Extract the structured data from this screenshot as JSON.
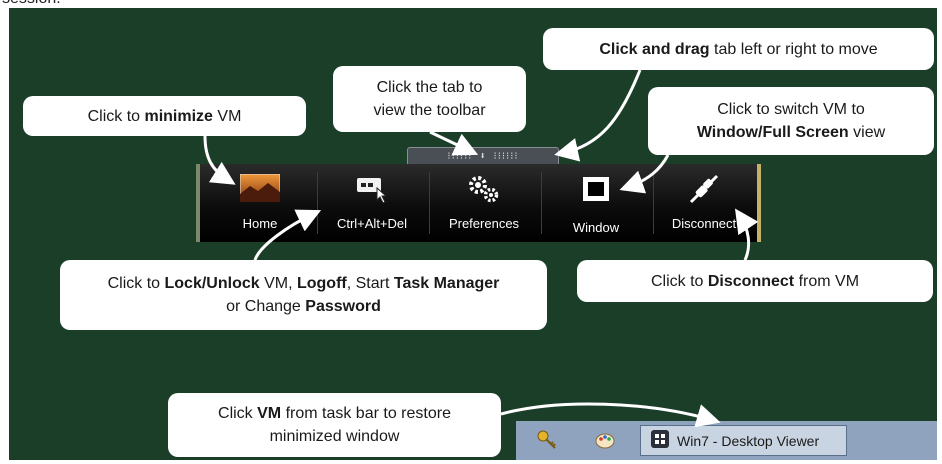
{
  "header_text": "session.",
  "toolbar_tab_label": "⁝⁝⁝⁝⁝⁝ ⬇ ⁝⁝⁝⁝⁝⁝",
  "toolbar": {
    "buttons": [
      {
        "label": "Home",
        "icon": "home-landscape-icon"
      },
      {
        "label": "Ctrl+Alt+Del",
        "icon": "ctrl-alt-del-icon"
      },
      {
        "label": "Preferences",
        "icon": "gears-icon"
      },
      {
        "label": "Window",
        "icon": "window-icon"
      },
      {
        "label": "Disconnect",
        "icon": "plug-icon"
      }
    ]
  },
  "callouts": {
    "drag_prefix_bold": "Click and drag",
    "drag_suffix": " tab left or right to move",
    "tab_line1": "Click the tab to",
    "tab_line2": "view the toolbar",
    "minimize_prefix": "Click to ",
    "minimize_bold": "minimize",
    "minimize_suffix": " VM",
    "window_line1": "Click to switch VM to",
    "window_bold": "Window/Full Screen",
    "window_suffix": " view",
    "ctrl_1": "Click to ",
    "ctrl_b1": "Lock/Unlock",
    "ctrl_2": " VM, ",
    "ctrl_b2": "Logoff",
    "ctrl_3": ", Start ",
    "ctrl_b3": "Task Manager",
    "ctrl_4": "or Change ",
    "ctrl_b4": "Password",
    "disc_prefix": "Click to ",
    "disc_bold": "Disconnect",
    "disc_suffix": " from VM",
    "task_prefix": "Click ",
    "task_bold": "VM",
    "task_suffix": " from task bar to restore",
    "task_line2": "minimized window"
  },
  "taskbar": {
    "item_label": "Win7 - Desktop Viewer",
    "tray_icons": [
      "keys-icon",
      "paint-icon"
    ]
  },
  "colors": {
    "board": "#1b3e29",
    "toolbar": "#000000",
    "taskbar": "#8fa3bf",
    "callout": "#ffffff"
  }
}
